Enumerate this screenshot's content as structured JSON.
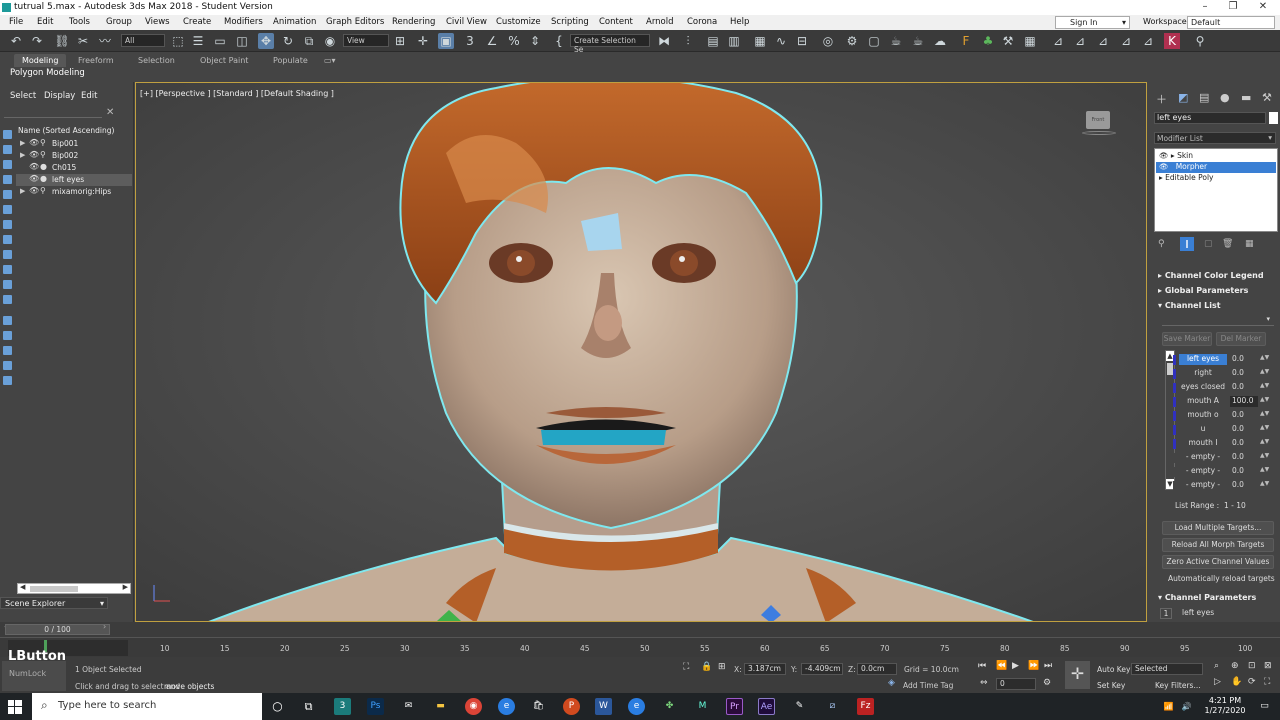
{
  "titlebar": {
    "title": "tutrual 5.max - Autodesk 3ds Max 2018 - Student Version",
    "minimize": "–",
    "restore": "❐",
    "close": "✕"
  },
  "menu": [
    "File",
    "Edit",
    "Tools",
    "Group",
    "Views",
    "Create",
    "Modifiers",
    "Animation",
    "Graph Editors",
    "Rendering",
    "Civil View",
    "Customize",
    "Scripting",
    "Content",
    "Arnold",
    "Corona",
    "Help"
  ],
  "account": {
    "sign_in": "Sign In",
    "workspaces_label": "Workspaces:",
    "workspace": "Default"
  },
  "toolbar": {
    "filter": "All",
    "refcoord": "View",
    "selection_set": "Create Selection Se"
  },
  "ribbon": {
    "tabs": [
      "Modeling",
      "Freeform",
      "Selection",
      "Object Paint",
      "Populate"
    ],
    "subtitle": "Polygon Modeling"
  },
  "scene_explorer": {
    "tabs": [
      "Select",
      "Display",
      "Edit"
    ],
    "header": "Name (Sorted Ascending)",
    "rows": [
      {
        "name": "Bip001",
        "arrow": "▶",
        "icon": "⚲"
      },
      {
        "name": "Bip002",
        "arrow": "▶",
        "icon": "⚲"
      },
      {
        "name": "Ch015",
        "arrow": "",
        "icon": "●"
      },
      {
        "name": "left eyes",
        "arrow": "",
        "icon": "●"
      },
      {
        "name": "mixamorig:Hips",
        "arrow": "▶",
        "icon": "⚲"
      }
    ],
    "footer": "Scene Explorer"
  },
  "viewport": {
    "label": "[+] [Perspective ] [Standard ] [Default Shading ]",
    "viewcube": "Front"
  },
  "command_panel": {
    "object_name": "left eyes",
    "modifier_list": "Modifier List",
    "stack": [
      "Skin",
      "Morpher",
      "Editable Poly"
    ],
    "rollouts": [
      "Channel Color Legend",
      "Global Parameters",
      "Channel List"
    ],
    "save_marker": "Save Marker",
    "del_marker": "Del Marker",
    "channels": [
      {
        "name": "left eyes",
        "value": "0.0"
      },
      {
        "name": "right",
        "value": "0.0"
      },
      {
        "name": "eyes closed",
        "value": "0.0"
      },
      {
        "name": "mouth A",
        "value": "100.0"
      },
      {
        "name": "mouth o",
        "value": "0.0"
      },
      {
        "name": "u",
        "value": "0.0"
      },
      {
        "name": "mouth I",
        "value": "0.0"
      },
      {
        "name": "- empty -",
        "value": "0.0"
      },
      {
        "name": "- empty -",
        "value": "0.0"
      },
      {
        "name": "- empty -",
        "value": "0.0"
      }
    ],
    "list_range_label": "List Range :",
    "list_range": "1 - 10",
    "buttons": [
      "Load Multiple Targets...",
      "Reload All Morph Targets",
      "Zero Active Channel Values"
    ],
    "auto_reload": "Automatically reload targets",
    "channel_params": "Channel Parameters",
    "channel_param_index": "1",
    "channel_param_name": "left eyes"
  },
  "timeline": {
    "frame": "0 / 100",
    "ticks": [
      "10",
      "15",
      "20",
      "25",
      "30",
      "35",
      "40",
      "45",
      "50",
      "55",
      "60",
      "65",
      "70",
      "75",
      "80",
      "85",
      "90",
      "95",
      "100"
    ]
  },
  "status": {
    "lbutton": "LButton",
    "numlock": "NumLock",
    "selected": "1 Object Selected",
    "prompt_a": "Click and drag to select and",
    "prompt_b": "move objects",
    "x_label": "X:",
    "x": "3.187cm",
    "y_label": "Y:",
    "y": "-4.409cm",
    "z_label": "Z:",
    "z": "0.0cm",
    "grid": "Grid = 10.0cm",
    "add_time_tag": "Add Time Tag",
    "auto_key": "Auto Key",
    "set_key": "Set Key",
    "selected_mode": "Selected",
    "key_filters": "Key Filters...",
    "frame_field": "0"
  },
  "taskbar": {
    "search": "Type here to search",
    "time": "4:21 PM",
    "date": "1/27/2020"
  }
}
